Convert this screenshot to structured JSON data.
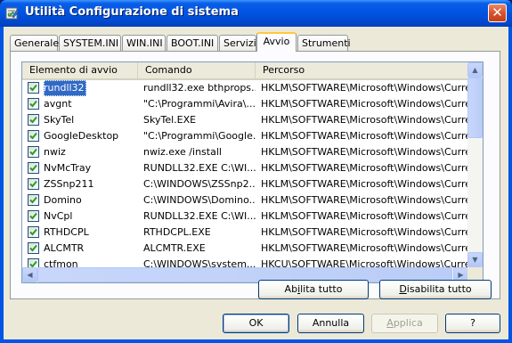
{
  "window": {
    "title": "Utilità Configurazione di sistema",
    "icon": "msconfig-icon",
    "close_label": "✕"
  },
  "tabs": [
    {
      "label": "Generale"
    },
    {
      "label": "SYSTEM.INI"
    },
    {
      "label": "WIN.INI"
    },
    {
      "label": "BOOT.INI"
    },
    {
      "label": "Servizi"
    },
    {
      "label": "Avvio",
      "active": true
    },
    {
      "label": "Strumenti"
    }
  ],
  "list": {
    "columns": [
      "Elemento di avvio",
      "Comando",
      "Percorso"
    ],
    "rows": [
      {
        "item": "rundll32",
        "command": "rundll32.exe bthprops....",
        "path": "HKLM\\SOFTWARE\\Microsoft\\Windows\\CurrentVer...",
        "checked": true,
        "selected": true
      },
      {
        "item": "avgnt",
        "command": "\"C:\\Programmi\\Avira\\...",
        "path": "HKLM\\SOFTWARE\\Microsoft\\Windows\\CurrentVer...",
        "checked": true
      },
      {
        "item": "SkyTel",
        "command": "SkyTel.EXE",
        "path": "HKLM\\SOFTWARE\\Microsoft\\Windows\\CurrentVer...",
        "checked": true
      },
      {
        "item": "GoogleDesktop",
        "command": "\"C:\\Programmi\\Google...",
        "path": "HKLM\\SOFTWARE\\Microsoft\\Windows\\CurrentVer...",
        "checked": true
      },
      {
        "item": "nwiz",
        "command": "nwiz.exe /install",
        "path": "HKLM\\SOFTWARE\\Microsoft\\Windows\\CurrentVer...",
        "checked": true
      },
      {
        "item": "NvMcTray",
        "command": "RUNDLL32.EXE C:\\WI...",
        "path": "HKLM\\SOFTWARE\\Microsoft\\Windows\\CurrentVer...",
        "checked": true
      },
      {
        "item": "ZSSnp211",
        "command": "C:\\WINDOWS\\ZSSnp2...",
        "path": "HKLM\\SOFTWARE\\Microsoft\\Windows\\CurrentVer...",
        "checked": true
      },
      {
        "item": "Domino",
        "command": "C:\\WINDOWS\\Domino...",
        "path": "HKLM\\SOFTWARE\\Microsoft\\Windows\\CurrentVer...",
        "checked": true
      },
      {
        "item": "NvCpl",
        "command": "RUNDLL32.EXE C:\\WI...",
        "path": "HKLM\\SOFTWARE\\Microsoft\\Windows\\CurrentVer...",
        "checked": true
      },
      {
        "item": "RTHDCPL",
        "command": "RTHDCPL.EXE",
        "path": "HKLM\\SOFTWARE\\Microsoft\\Windows\\CurrentVer...",
        "checked": true
      },
      {
        "item": "ALCMTR",
        "command": "ALCMTR.EXE",
        "path": "HKLM\\SOFTWARE\\Microsoft\\Windows\\CurrentVer...",
        "checked": true
      },
      {
        "item": "ctfmon",
        "command": "C:\\WINDOWS\\system...",
        "path": "HKCU\\SOFTWARE\\Microsoft\\Windows\\CurrentVer...",
        "checked": true
      }
    ]
  },
  "panel_buttons": {
    "enable_all_pre": "Ab",
    "enable_all_key": "i",
    "enable_all_post": "lita tutto",
    "disable_all_pre": "",
    "disable_all_key": "D",
    "disable_all_post": "isabilita tutto"
  },
  "dialog_buttons": {
    "ok": "OK",
    "cancel": "Annulla",
    "apply_pre": "",
    "apply_key": "A",
    "apply_post": "pplica",
    "help": "?"
  },
  "colors": {
    "titlebar": "#0054e3",
    "selection": "#316ac5",
    "active_tab_accent": "#ffc83c",
    "checkmark": "#21a121"
  }
}
